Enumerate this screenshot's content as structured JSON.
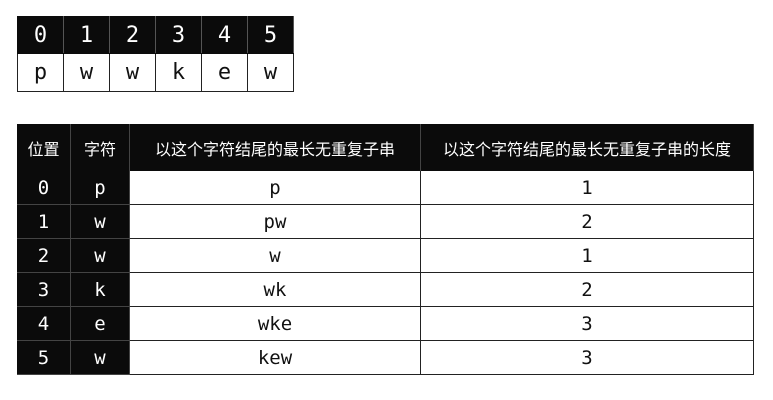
{
  "array": {
    "indices": [
      "0",
      "1",
      "2",
      "3",
      "4",
      "5"
    ],
    "chars": [
      "p",
      "w",
      "w",
      "k",
      "e",
      "w"
    ]
  },
  "table": {
    "headers": [
      "位置",
      "字符",
      "以这个字符结尾的最长无重复子串",
      "以这个字符结尾的最长无重复子串的长度"
    ],
    "rows": [
      [
        "0",
        "p",
        "p",
        "1"
      ],
      [
        "1",
        "w",
        "pw",
        "2"
      ],
      [
        "2",
        "w",
        "w",
        "1"
      ],
      [
        "3",
        "k",
        "wk",
        "2"
      ],
      [
        "4",
        "e",
        "wke",
        "3"
      ],
      [
        "5",
        "w",
        "kew",
        "3"
      ]
    ]
  }
}
